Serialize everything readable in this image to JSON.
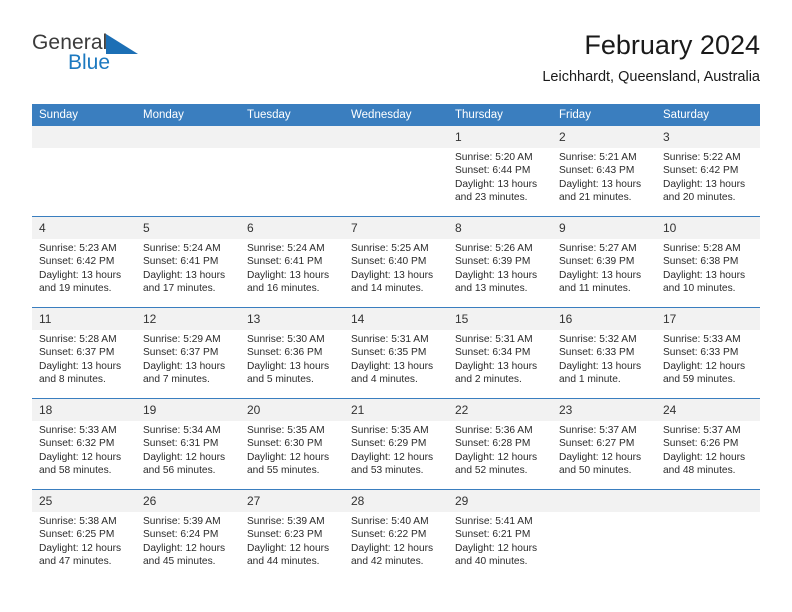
{
  "brand": {
    "name_part1": "General",
    "name_part2": "Blue",
    "triangle_color": "#1c6fb5"
  },
  "header": {
    "title": "February 2024",
    "subtitle": "Leichhardt, Queensland, Australia"
  },
  "theme": {
    "header_blue": "#3a7ebf",
    "daynum_gray": "#f2f2f2",
    "text": "#2b2b2b"
  },
  "weekdays": [
    "Sunday",
    "Monday",
    "Tuesday",
    "Wednesday",
    "Thursday",
    "Friday",
    "Saturday"
  ],
  "weeks": [
    [
      {
        "day": "",
        "empty": true
      },
      {
        "day": "",
        "empty": true
      },
      {
        "day": "",
        "empty": true
      },
      {
        "day": "",
        "empty": true
      },
      {
        "day": "1",
        "sunrise": "Sunrise: 5:20 AM",
        "sunset": "Sunset: 6:44 PM",
        "daylight_l1": "Daylight: 13 hours",
        "daylight_l2": "and 23 minutes."
      },
      {
        "day": "2",
        "sunrise": "Sunrise: 5:21 AM",
        "sunset": "Sunset: 6:43 PM",
        "daylight_l1": "Daylight: 13 hours",
        "daylight_l2": "and 21 minutes."
      },
      {
        "day": "3",
        "sunrise": "Sunrise: 5:22 AM",
        "sunset": "Sunset: 6:42 PM",
        "daylight_l1": "Daylight: 13 hours",
        "daylight_l2": "and 20 minutes."
      }
    ],
    [
      {
        "day": "4",
        "sunrise": "Sunrise: 5:23 AM",
        "sunset": "Sunset: 6:42 PM",
        "daylight_l1": "Daylight: 13 hours",
        "daylight_l2": "and 19 minutes."
      },
      {
        "day": "5",
        "sunrise": "Sunrise: 5:24 AM",
        "sunset": "Sunset: 6:41 PM",
        "daylight_l1": "Daylight: 13 hours",
        "daylight_l2": "and 17 minutes."
      },
      {
        "day": "6",
        "sunrise": "Sunrise: 5:24 AM",
        "sunset": "Sunset: 6:41 PM",
        "daylight_l1": "Daylight: 13 hours",
        "daylight_l2": "and 16 minutes."
      },
      {
        "day": "7",
        "sunrise": "Sunrise: 5:25 AM",
        "sunset": "Sunset: 6:40 PM",
        "daylight_l1": "Daylight: 13 hours",
        "daylight_l2": "and 14 minutes."
      },
      {
        "day": "8",
        "sunrise": "Sunrise: 5:26 AM",
        "sunset": "Sunset: 6:39 PM",
        "daylight_l1": "Daylight: 13 hours",
        "daylight_l2": "and 13 minutes."
      },
      {
        "day": "9",
        "sunrise": "Sunrise: 5:27 AM",
        "sunset": "Sunset: 6:39 PM",
        "daylight_l1": "Daylight: 13 hours",
        "daylight_l2": "and 11 minutes."
      },
      {
        "day": "10",
        "sunrise": "Sunrise: 5:28 AM",
        "sunset": "Sunset: 6:38 PM",
        "daylight_l1": "Daylight: 13 hours",
        "daylight_l2": "and 10 minutes."
      }
    ],
    [
      {
        "day": "11",
        "sunrise": "Sunrise: 5:28 AM",
        "sunset": "Sunset: 6:37 PM",
        "daylight_l1": "Daylight: 13 hours",
        "daylight_l2": "and 8 minutes."
      },
      {
        "day": "12",
        "sunrise": "Sunrise: 5:29 AM",
        "sunset": "Sunset: 6:37 PM",
        "daylight_l1": "Daylight: 13 hours",
        "daylight_l2": "and 7 minutes."
      },
      {
        "day": "13",
        "sunrise": "Sunrise: 5:30 AM",
        "sunset": "Sunset: 6:36 PM",
        "daylight_l1": "Daylight: 13 hours",
        "daylight_l2": "and 5 minutes."
      },
      {
        "day": "14",
        "sunrise": "Sunrise: 5:31 AM",
        "sunset": "Sunset: 6:35 PM",
        "daylight_l1": "Daylight: 13 hours",
        "daylight_l2": "and 4 minutes."
      },
      {
        "day": "15",
        "sunrise": "Sunrise: 5:31 AM",
        "sunset": "Sunset: 6:34 PM",
        "daylight_l1": "Daylight: 13 hours",
        "daylight_l2": "and 2 minutes."
      },
      {
        "day": "16",
        "sunrise": "Sunrise: 5:32 AM",
        "sunset": "Sunset: 6:33 PM",
        "daylight_l1": "Daylight: 13 hours",
        "daylight_l2": "and 1 minute."
      },
      {
        "day": "17",
        "sunrise": "Sunrise: 5:33 AM",
        "sunset": "Sunset: 6:33 PM",
        "daylight_l1": "Daylight: 12 hours",
        "daylight_l2": "and 59 minutes."
      }
    ],
    [
      {
        "day": "18",
        "sunrise": "Sunrise: 5:33 AM",
        "sunset": "Sunset: 6:32 PM",
        "daylight_l1": "Daylight: 12 hours",
        "daylight_l2": "and 58 minutes."
      },
      {
        "day": "19",
        "sunrise": "Sunrise: 5:34 AM",
        "sunset": "Sunset: 6:31 PM",
        "daylight_l1": "Daylight: 12 hours",
        "daylight_l2": "and 56 minutes."
      },
      {
        "day": "20",
        "sunrise": "Sunrise: 5:35 AM",
        "sunset": "Sunset: 6:30 PM",
        "daylight_l1": "Daylight: 12 hours",
        "daylight_l2": "and 55 minutes."
      },
      {
        "day": "21",
        "sunrise": "Sunrise: 5:35 AM",
        "sunset": "Sunset: 6:29 PM",
        "daylight_l1": "Daylight: 12 hours",
        "daylight_l2": "and 53 minutes."
      },
      {
        "day": "22",
        "sunrise": "Sunrise: 5:36 AM",
        "sunset": "Sunset: 6:28 PM",
        "daylight_l1": "Daylight: 12 hours",
        "daylight_l2": "and 52 minutes."
      },
      {
        "day": "23",
        "sunrise": "Sunrise: 5:37 AM",
        "sunset": "Sunset: 6:27 PM",
        "daylight_l1": "Daylight: 12 hours",
        "daylight_l2": "and 50 minutes."
      },
      {
        "day": "24",
        "sunrise": "Sunrise: 5:37 AM",
        "sunset": "Sunset: 6:26 PM",
        "daylight_l1": "Daylight: 12 hours",
        "daylight_l2": "and 48 minutes."
      }
    ],
    [
      {
        "day": "25",
        "sunrise": "Sunrise: 5:38 AM",
        "sunset": "Sunset: 6:25 PM",
        "daylight_l1": "Daylight: 12 hours",
        "daylight_l2": "and 47 minutes."
      },
      {
        "day": "26",
        "sunrise": "Sunrise: 5:39 AM",
        "sunset": "Sunset: 6:24 PM",
        "daylight_l1": "Daylight: 12 hours",
        "daylight_l2": "and 45 minutes."
      },
      {
        "day": "27",
        "sunrise": "Sunrise: 5:39 AM",
        "sunset": "Sunset: 6:23 PM",
        "daylight_l1": "Daylight: 12 hours",
        "daylight_l2": "and 44 minutes."
      },
      {
        "day": "28",
        "sunrise": "Sunrise: 5:40 AM",
        "sunset": "Sunset: 6:22 PM",
        "daylight_l1": "Daylight: 12 hours",
        "daylight_l2": "and 42 minutes."
      },
      {
        "day": "29",
        "sunrise": "Sunrise: 5:41 AM",
        "sunset": "Sunset: 6:21 PM",
        "daylight_l1": "Daylight: 12 hours",
        "daylight_l2": "and 40 minutes."
      },
      {
        "day": "",
        "empty": true
      },
      {
        "day": "",
        "empty": true
      }
    ]
  ]
}
